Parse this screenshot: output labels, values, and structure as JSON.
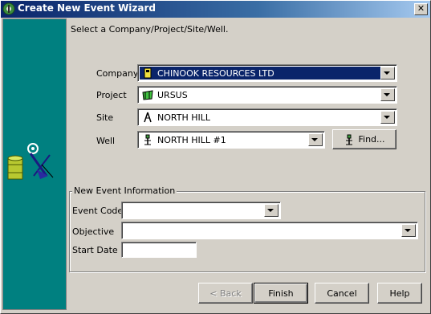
{
  "window": {
    "title": "Create New Event Wizard",
    "close_glyph": "✕"
  },
  "instruction": "Select a Company/Project/Site/Well.",
  "selection": {
    "company": {
      "label": "Company",
      "value": "CHINOOK RESOURCES LTD",
      "icon": "company-icon"
    },
    "project": {
      "label": "Project",
      "value": "URSUS",
      "icon": "project-icon"
    },
    "site": {
      "label": "Site",
      "value": "NORTH HILL",
      "icon": "site-icon"
    },
    "well": {
      "label": "Well",
      "value": "NORTH HILL #1",
      "icon": "well-icon"
    },
    "find_label": "Find..."
  },
  "event_info": {
    "group_title": "New Event Information",
    "event_code_label": "Event Code",
    "event_code_value": "",
    "objective_label": "Objective",
    "objective_value": "",
    "start_date_label": "Start Date",
    "start_date_value": ""
  },
  "buttons": {
    "back": "< Back",
    "finish": "Finish",
    "cancel": "Cancel",
    "help": "Help"
  },
  "colors": {
    "side_panel": "#008080",
    "selection_highlight": "#0a246a",
    "title_bar": "#0a246a"
  }
}
